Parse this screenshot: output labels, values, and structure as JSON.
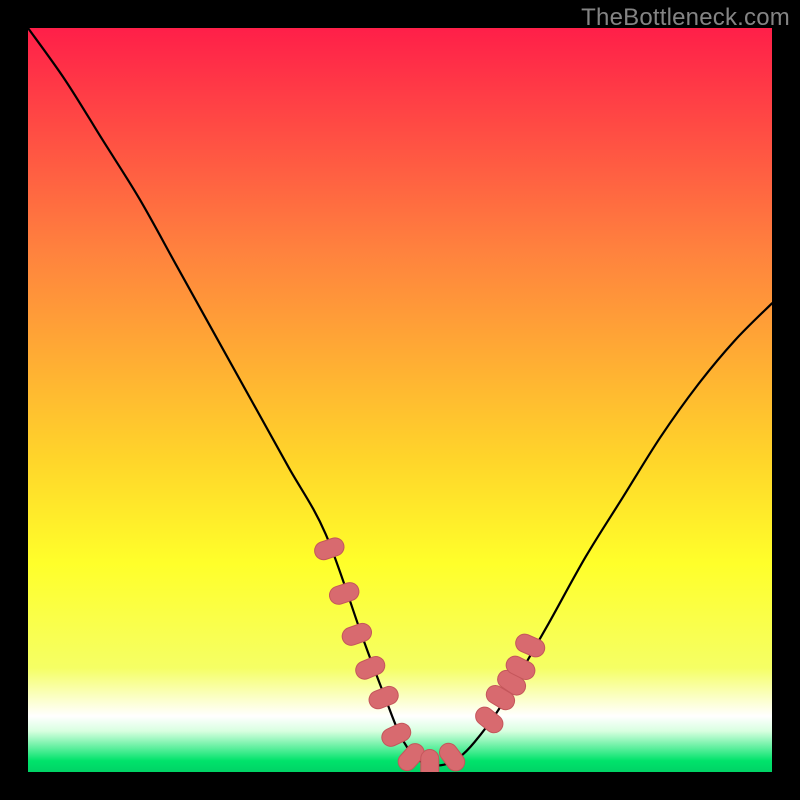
{
  "watermark": "TheBottleneck.com",
  "colors": {
    "frame": "#000000",
    "grad_top": "#ff1f49",
    "grad_upper_mid": "#ff823e",
    "grad_mid": "#ffd52a",
    "grad_lower_mid": "#ffff2a",
    "grad_low": "#f5ff64",
    "grad_band_pale": "#fcffd2",
    "grad_bottom": "#00e36b",
    "curve": "#000000",
    "marker_fill": "#d86a6f",
    "marker_stroke": "#c4565b"
  },
  "chart_data": {
    "type": "line",
    "title": "",
    "xlabel": "",
    "ylabel": "",
    "x_range": [
      0,
      100
    ],
    "y_range": [
      0,
      100
    ],
    "series": [
      {
        "name": "bottleneck-curve",
        "x": [
          0,
          5,
          10,
          15,
          20,
          25,
          30,
          35,
          40,
          45,
          48,
          50,
          52,
          54,
          56,
          58,
          60,
          63,
          66,
          70,
          75,
          80,
          85,
          90,
          95,
          100
        ],
        "y": [
          100,
          93,
          85,
          77,
          68,
          59,
          50,
          41,
          32,
          18,
          10,
          5,
          2,
          1,
          1,
          2,
          4,
          8,
          13,
          20,
          29,
          37,
          45,
          52,
          58,
          63
        ]
      }
    ],
    "markers": {
      "name": "highlight-points",
      "x": [
        40.5,
        42.5,
        44.2,
        46.0,
        47.8,
        49.5,
        51.5,
        54.0,
        57.0,
        62.0,
        63.5,
        65.0,
        66.2,
        67.5
      ],
      "y": [
        30.0,
        24.0,
        18.5,
        14.0,
        10.0,
        5.0,
        2.0,
        1.0,
        2.0,
        7.0,
        10.0,
        12.0,
        14.0,
        17.0
      ]
    }
  }
}
